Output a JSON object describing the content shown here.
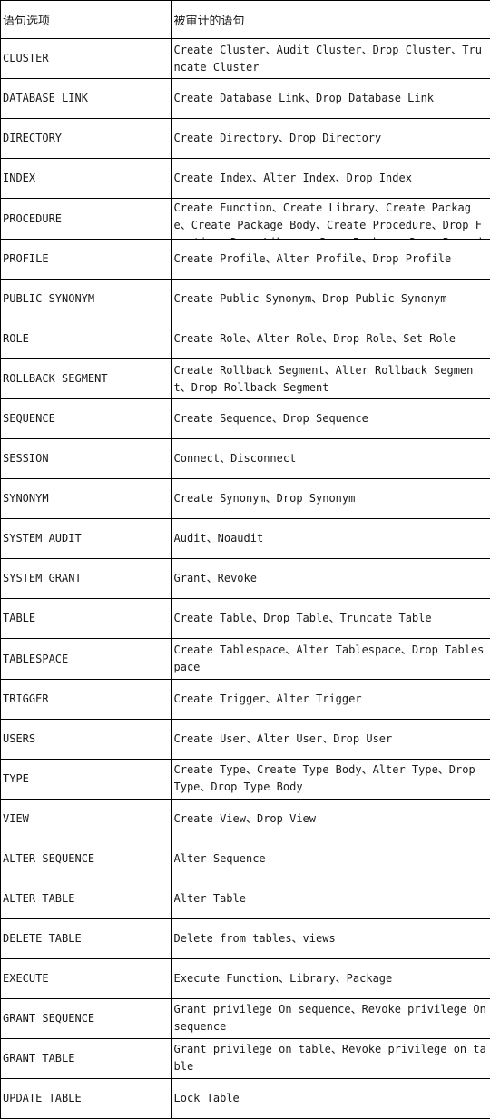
{
  "table": {
    "headers": [
      "语句选项",
      "被审计的语句"
    ],
    "rows": [
      [
        "CLUSTER",
        "Create Cluster、Audit Cluster、Drop Cluster、Truncate Cluster"
      ],
      [
        "DATABASE LINK",
        "Create Database Link、Drop Database Link"
      ],
      [
        "DIRECTORY",
        "Create Directory、Drop Directory"
      ],
      [
        "INDEX",
        "Create Index、Alter Index、Drop Index"
      ],
      [
        "PROCEDURE",
        "Create Function、Create Library、Create Package、Create Package Body、Create Procedure、Drop Function、Drop Library、Drop Package、Drop Procedure"
      ],
      [
        "PROFILE",
        "Create Profile、Alter Profile、Drop Profile"
      ],
      [
        "PUBLIC SYNONYM",
        "Create Public Synonym、Drop Public Synonym"
      ],
      [
        "ROLE",
        "Create Role、Alter Role、Drop Role、Set Role"
      ],
      [
        "ROLLBACK SEGMENT",
        "Create Rollback Segment、Alter Rollback Segment、Drop Rollback Segment"
      ],
      [
        "SEQUENCE",
        "Create Sequence、Drop Sequence"
      ],
      [
        "SESSION",
        "Connect、Disconnect"
      ],
      [
        "SYNONYM",
        "Create Synonym、Drop Synonym"
      ],
      [
        "SYSTEM AUDIT",
        "Audit、Noaudit"
      ],
      [
        "SYSTEM GRANT",
        "Grant、Revoke"
      ],
      [
        "TABLE",
        "Create Table、Drop Table、Truncate Table"
      ],
      [
        "TABLESPACE",
        "Create Tablespace、Alter Tablespace、Drop Tablespace"
      ],
      [
        "TRIGGER",
        "Create Trigger、Alter Trigger"
      ],
      [
        "USERS",
        "Create User、Alter User、Drop User"
      ],
      [
        "TYPE",
        "Create Type、Create Type Body、Alter Type、Drop Type、Drop Type Body"
      ],
      [
        "VIEW",
        "Create View、Drop View"
      ],
      [
        "ALTER SEQUENCE",
        "Alter Sequence"
      ],
      [
        "ALTER TABLE",
        "Alter Table"
      ],
      [
        "DELETE TABLE",
        "Delete from tables、views"
      ],
      [
        "EXECUTE",
        "Execute Function、Library、Package"
      ],
      [
        "GRANT SEQUENCE",
        "Grant privilege On sequence、Revoke privilege On sequence"
      ],
      [
        "GRANT TABLE",
        "Grant privilege on table、Revoke privilege on table"
      ],
      [
        "UPDATE TABLE",
        "Lock Table"
      ]
    ]
  }
}
